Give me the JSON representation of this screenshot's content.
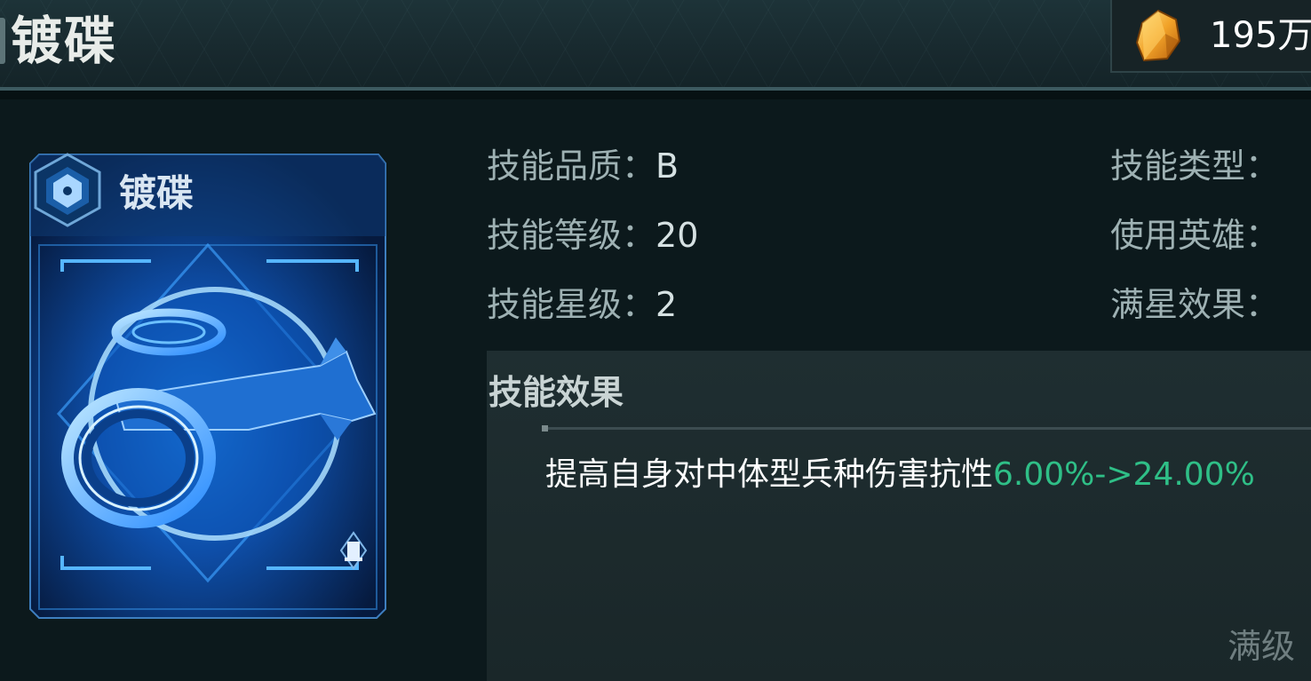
{
  "header": {
    "title": "镀碟",
    "currency": {
      "icon": "amber-crystal-icon",
      "value": "195万"
    }
  },
  "card": {
    "name": "镀碟",
    "class_icon": "hexagon-class-icon",
    "art_icon": "blue-rings-drone-icon",
    "corner_icon": "tower-icon"
  },
  "info_left": [
    {
      "label": "技能品质：",
      "value": "B"
    },
    {
      "label": "技能等级：",
      "value": "20"
    },
    {
      "label": "技能星级：",
      "value": "2"
    }
  ],
  "info_right": [
    {
      "label": "技能类型：",
      "value": ""
    },
    {
      "label": "使用英雄：",
      "value": ""
    },
    {
      "label": "满星效果：",
      "value": ""
    }
  ],
  "effect": {
    "title": "技能效果",
    "description": "提高自身对中体型兵种伤害抗性",
    "highlight": "6.00%->24.00%",
    "max_level_label": "满级"
  },
  "colors": {
    "highlight": "#2fbf87",
    "card_glow": "#1e8fff",
    "text_label": "#9eb1b3"
  }
}
